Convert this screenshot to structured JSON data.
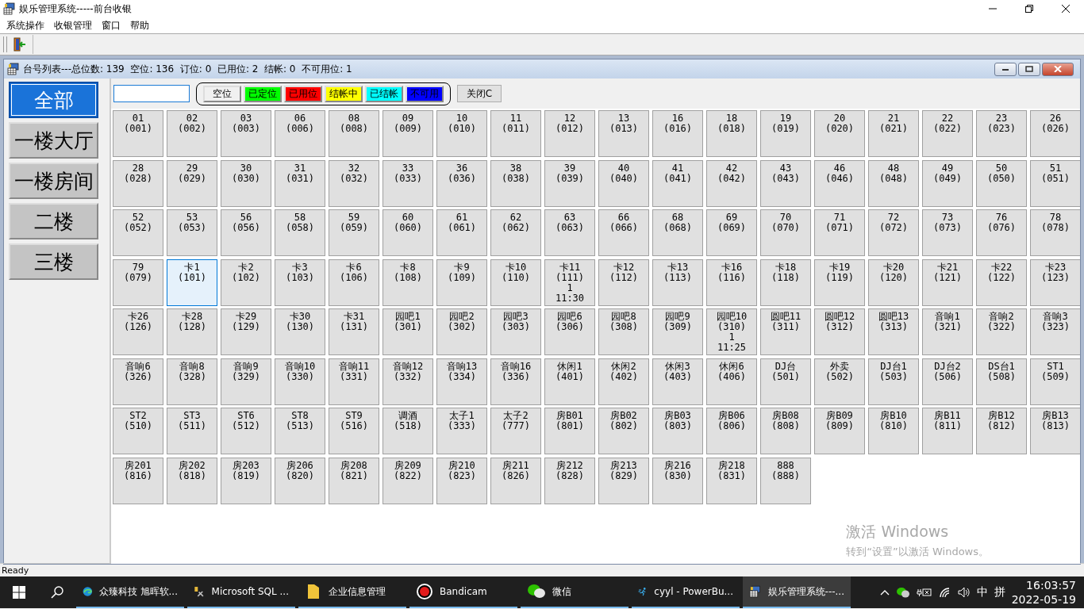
{
  "window": {
    "title": "娱乐管理系统-----前台收银"
  },
  "menu": [
    "系统操作",
    "收银管理",
    "窗口",
    "帮助"
  ],
  "child_window": {
    "title": "台号列表---总位数: 139  空位: 136  订位: 0  已用位: 2  结帐: 0  不可用位: 1"
  },
  "categories": [
    {
      "label": "全部",
      "selected": true
    },
    {
      "label": "一楼大厅",
      "selected": false
    },
    {
      "label": "一楼房间",
      "selected": false
    },
    {
      "label": "二楼",
      "selected": false
    },
    {
      "label": "三楼",
      "selected": false
    }
  ],
  "legend": [
    {
      "label": "空位",
      "color": "#f0f0f0"
    },
    {
      "label": "已定位",
      "color": "#00ff00"
    },
    {
      "label": "已用位",
      "color": "#ff0000"
    },
    {
      "label": "结帐中",
      "color": "#ffff00"
    },
    {
      "label": "已结帐",
      "color": "#00ffff"
    },
    {
      "label": "不可用",
      "color": "#0000ff"
    }
  ],
  "close_button": "关闭C",
  "tables": [
    {
      "name": "01",
      "code": "(001)",
      "selected": false
    },
    {
      "name": "02",
      "code": "(002)",
      "selected": false
    },
    {
      "name": "03",
      "code": "(003)",
      "selected": false
    },
    {
      "name": "06",
      "code": "(006)",
      "selected": false
    },
    {
      "name": "08",
      "code": "(008)",
      "selected": false
    },
    {
      "name": "09",
      "code": "(009)",
      "selected": false
    },
    {
      "name": "10",
      "code": "(010)",
      "selected": false
    },
    {
      "name": "11",
      "code": "(011)",
      "selected": false
    },
    {
      "name": "12",
      "code": "(012)",
      "selected": false
    },
    {
      "name": "13",
      "code": "(013)",
      "selected": false
    },
    {
      "name": "16",
      "code": "(016)",
      "selected": false
    },
    {
      "name": "18",
      "code": "(018)",
      "selected": false
    },
    {
      "name": "19",
      "code": "(019)",
      "selected": false
    },
    {
      "name": "20",
      "code": "(020)",
      "selected": false
    },
    {
      "name": "21",
      "code": "(021)",
      "selected": false
    },
    {
      "name": "22",
      "code": "(022)",
      "selected": false
    },
    {
      "name": "23",
      "code": "(023)",
      "selected": false
    },
    {
      "name": "26",
      "code": "(026)",
      "selected": false
    },
    {
      "name": "28",
      "code": "(028)",
      "selected": false
    },
    {
      "name": "29",
      "code": "(029)",
      "selected": false
    },
    {
      "name": "30",
      "code": "(030)",
      "selected": false
    },
    {
      "name": "31",
      "code": "(031)",
      "selected": false
    },
    {
      "name": "32",
      "code": "(032)",
      "selected": false
    },
    {
      "name": "33",
      "code": "(033)",
      "selected": false
    },
    {
      "name": "36",
      "code": "(036)",
      "selected": false
    },
    {
      "name": "38",
      "code": "(038)",
      "selected": false
    },
    {
      "name": "39",
      "code": "(039)",
      "selected": false
    },
    {
      "name": "40",
      "code": "(040)",
      "selected": false
    },
    {
      "name": "41",
      "code": "(041)",
      "selected": false
    },
    {
      "name": "42",
      "code": "(042)",
      "selected": false
    },
    {
      "name": "43",
      "code": "(043)",
      "selected": false
    },
    {
      "name": "46",
      "code": "(046)",
      "selected": false
    },
    {
      "name": "48",
      "code": "(048)",
      "selected": false
    },
    {
      "name": "49",
      "code": "(049)",
      "selected": false
    },
    {
      "name": "50",
      "code": "(050)",
      "selected": false
    },
    {
      "name": "51",
      "code": "(051)",
      "selected": false
    },
    {
      "name": "52",
      "code": "(052)",
      "selected": false
    },
    {
      "name": "53",
      "code": "(053)",
      "selected": false
    },
    {
      "name": "56",
      "code": "(056)",
      "selected": false
    },
    {
      "name": "58",
      "code": "(058)",
      "selected": false
    },
    {
      "name": "59",
      "code": "(059)",
      "selected": false
    },
    {
      "name": "60",
      "code": "(060)",
      "selected": false
    },
    {
      "name": "61",
      "code": "(061)",
      "selected": false
    },
    {
      "name": "62",
      "code": "(062)",
      "selected": false
    },
    {
      "name": "63",
      "code": "(063)",
      "selected": false
    },
    {
      "name": "66",
      "code": "(066)",
      "selected": false
    },
    {
      "name": "68",
      "code": "(068)",
      "selected": false
    },
    {
      "name": "69",
      "code": "(069)",
      "selected": false
    },
    {
      "name": "70",
      "code": "(070)",
      "selected": false
    },
    {
      "name": "71",
      "code": "(071)",
      "selected": false
    },
    {
      "name": "72",
      "code": "(072)",
      "selected": false
    },
    {
      "name": "73",
      "code": "(073)",
      "selected": false
    },
    {
      "name": "76",
      "code": "(076)",
      "selected": false
    },
    {
      "name": "78",
      "code": "(078)",
      "selected": false
    },
    {
      "name": "79",
      "code": "(079)",
      "selected": false
    },
    {
      "name": "卡1",
      "code": "(101)",
      "selected": true
    },
    {
      "name": "卡2",
      "code": "(102)",
      "selected": false
    },
    {
      "name": "卡3",
      "code": "(103)",
      "selected": false
    },
    {
      "name": "卡6",
      "code": "(106)",
      "selected": false
    },
    {
      "name": "卡8",
      "code": "(108)",
      "selected": false
    },
    {
      "name": "卡9",
      "code": "(109)",
      "selected": false
    },
    {
      "name": "卡10",
      "code": "(110)",
      "selected": false
    },
    {
      "name": "卡11",
      "code": "(111)",
      "guests": "1",
      "time": "11:30",
      "selected": false
    },
    {
      "name": "卡12",
      "code": "(112)",
      "selected": false
    },
    {
      "name": "卡13",
      "code": "(113)",
      "selected": false
    },
    {
      "name": "卡16",
      "code": "(116)",
      "selected": false
    },
    {
      "name": "卡18",
      "code": "(118)",
      "selected": false
    },
    {
      "name": "卡19",
      "code": "(119)",
      "selected": false
    },
    {
      "name": "卡20",
      "code": "(120)",
      "selected": false
    },
    {
      "name": "卡21",
      "code": "(121)",
      "selected": false
    },
    {
      "name": "卡22",
      "code": "(122)",
      "selected": false
    },
    {
      "name": "卡23",
      "code": "(123)",
      "selected": false
    },
    {
      "name": "卡26",
      "code": "(126)",
      "selected": false
    },
    {
      "name": "卡28",
      "code": "(128)",
      "selected": false
    },
    {
      "name": "卡29",
      "code": "(129)",
      "selected": false
    },
    {
      "name": "卡30",
      "code": "(130)",
      "selected": false
    },
    {
      "name": "卡31",
      "code": "(131)",
      "selected": false
    },
    {
      "name": "园吧1",
      "code": "(301)",
      "selected": false
    },
    {
      "name": "园吧2",
      "code": "(302)",
      "selected": false
    },
    {
      "name": "园吧3",
      "code": "(303)",
      "selected": false
    },
    {
      "name": "园吧6",
      "code": "(306)",
      "selected": false
    },
    {
      "name": "园吧8",
      "code": "(308)",
      "selected": false
    },
    {
      "name": "园吧9",
      "code": "(309)",
      "selected": false
    },
    {
      "name": "园吧10",
      "code": "(310)",
      "guests": "1",
      "time": "11:25",
      "selected": false
    },
    {
      "name": "圆吧11",
      "code": "(311)",
      "selected": false
    },
    {
      "name": "圆吧12",
      "code": "(312)",
      "selected": false
    },
    {
      "name": "圆吧13",
      "code": "(313)",
      "selected": false
    },
    {
      "name": "音响1",
      "code": "(321)",
      "selected": false
    },
    {
      "name": "音响2",
      "code": "(322)",
      "selected": false
    },
    {
      "name": "音响3",
      "code": "(323)",
      "selected": false
    },
    {
      "name": "音响6",
      "code": "(326)",
      "selected": false
    },
    {
      "name": "音响8",
      "code": "(328)",
      "selected": false
    },
    {
      "name": "音响9",
      "code": "(329)",
      "selected": false
    },
    {
      "name": "音响10",
      "code": "(330)",
      "selected": false
    },
    {
      "name": "音响11",
      "code": "(331)",
      "selected": false
    },
    {
      "name": "音响12",
      "code": "(332)",
      "selected": false
    },
    {
      "name": "音响13",
      "code": "(334)",
      "selected": false
    },
    {
      "name": "音响16",
      "code": "(336)",
      "selected": false
    },
    {
      "name": "休闲1",
      "code": "(401)",
      "selected": false
    },
    {
      "name": "休闲2",
      "code": "(402)",
      "selected": false
    },
    {
      "name": "休闲3",
      "code": "(403)",
      "selected": false
    },
    {
      "name": "休闲6",
      "code": "(406)",
      "selected": false
    },
    {
      "name": "DJ台",
      "code": "(501)",
      "selected": false
    },
    {
      "name": "外卖",
      "code": "(502)",
      "selected": false
    },
    {
      "name": "DJ台1",
      "code": "(503)",
      "selected": false
    },
    {
      "name": "DJ台2",
      "code": "(506)",
      "selected": false
    },
    {
      "name": "DS台1",
      "code": "(508)",
      "selected": false
    },
    {
      "name": "ST1",
      "code": "(509)",
      "selected": false
    },
    {
      "name": "ST2",
      "code": "(510)",
      "selected": false
    },
    {
      "name": "ST3",
      "code": "(511)",
      "selected": false
    },
    {
      "name": "ST6",
      "code": "(512)",
      "selected": false
    },
    {
      "name": "ST8",
      "code": "(513)",
      "selected": false
    },
    {
      "name": "ST9",
      "code": "(516)",
      "selected": false
    },
    {
      "name": "调酒",
      "code": "(518)",
      "selected": false
    },
    {
      "name": "太子1",
      "code": "(333)",
      "selected": false
    },
    {
      "name": "太子2",
      "code": "(777)",
      "selected": false
    },
    {
      "name": "房B01",
      "code": "(801)",
      "selected": false
    },
    {
      "name": "房B02",
      "code": "(802)",
      "selected": false
    },
    {
      "name": "房B03",
      "code": "(803)",
      "selected": false
    },
    {
      "name": "房B06",
      "code": "(806)",
      "selected": false
    },
    {
      "name": "房B08",
      "code": "(808)",
      "selected": false
    },
    {
      "name": "房B09",
      "code": "(809)",
      "selected": false
    },
    {
      "name": "房B10",
      "code": "(810)",
      "selected": false
    },
    {
      "name": "房B11",
      "code": "(811)",
      "selected": false
    },
    {
      "name": "房B12",
      "code": "(812)",
      "selected": false
    },
    {
      "name": "房B13",
      "code": "(813)",
      "selected": false
    },
    {
      "name": "房201",
      "code": "(816)",
      "selected": false
    },
    {
      "name": "房202",
      "code": "(818)",
      "selected": false
    },
    {
      "name": "房203",
      "code": "(819)",
      "selected": false
    },
    {
      "name": "房206",
      "code": "(820)",
      "selected": false
    },
    {
      "name": "房208",
      "code": "(821)",
      "selected": false
    },
    {
      "name": "房209",
      "code": "(822)",
      "selected": false
    },
    {
      "name": "房210",
      "code": "(823)",
      "selected": false
    },
    {
      "name": "房211",
      "code": "(826)",
      "selected": false
    },
    {
      "name": "房212",
      "code": "(828)",
      "selected": false
    },
    {
      "name": "房213",
      "code": "(829)",
      "selected": false
    },
    {
      "name": "房216",
      "code": "(830)",
      "selected": false
    },
    {
      "name": "房218",
      "code": "(831)",
      "selected": false
    },
    {
      "name": "888",
      "code": "(888)",
      "selected": false
    }
  ],
  "activation_notice": {
    "title": "激活 Windows",
    "text": "转到“设置”以激活 Windows。"
  },
  "status_bar": "Ready",
  "taskbar": {
    "apps": [
      {
        "label": "众臻科技 旭晖软...",
        "kind": "browser",
        "selected": false
      },
      {
        "label": "Microsoft SQL ...",
        "kind": "tools",
        "selected": false
      },
      {
        "label": "企业信息管理",
        "kind": "folder",
        "selected": false
      },
      {
        "label": "Bandicam",
        "kind": "record",
        "selected": false
      },
      {
        "label": "微信",
        "kind": "chat",
        "selected": false
      },
      {
        "label": "cyyl - PowerBu...",
        "kind": "runner",
        "selected": false
      },
      {
        "label": "娱乐管理系统---...",
        "kind": "app",
        "selected": true
      }
    ],
    "ime_mode": "中",
    "ime_name": "拼",
    "time": "16:03:57",
    "date": "2022-05-19"
  }
}
